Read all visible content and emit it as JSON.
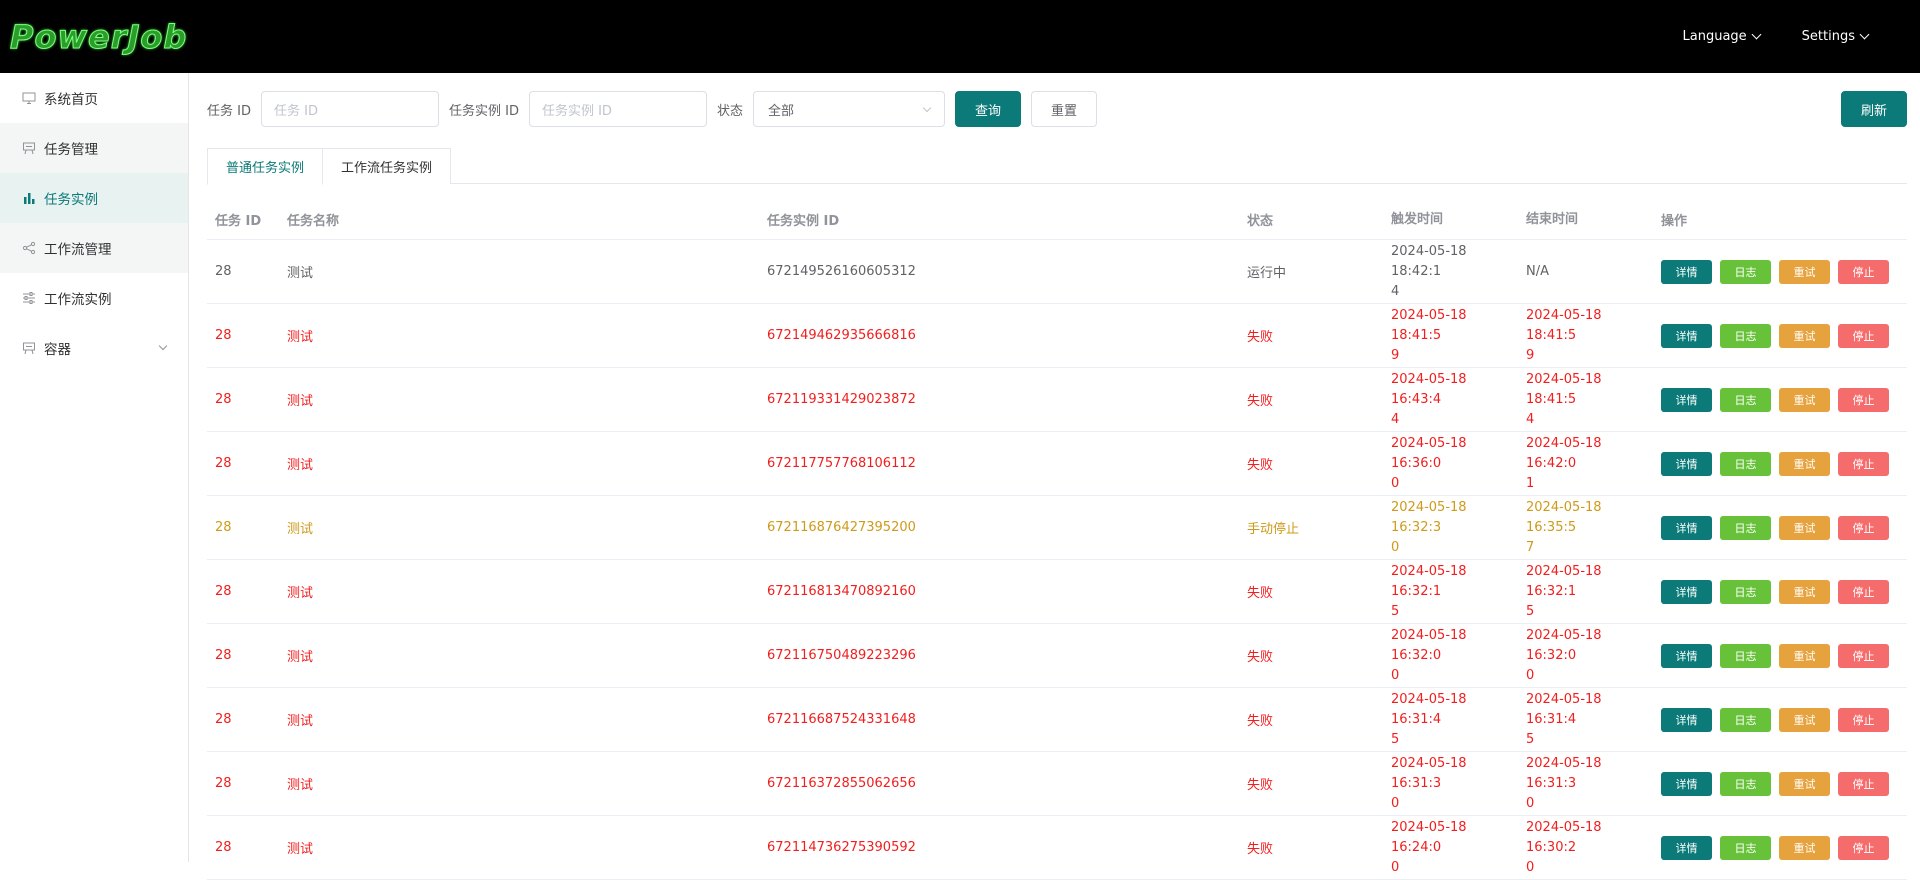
{
  "header": {
    "logo": "PowerJob",
    "language_label": "Language",
    "settings_label": "Settings"
  },
  "sidebar": {
    "items": [
      {
        "label": "系统首页",
        "icon": "monitor-icon"
      },
      {
        "label": "任务管理",
        "icon": "task-manage-icon"
      },
      {
        "label": "任务实例",
        "icon": "bar-chart-icon"
      },
      {
        "label": "工作流管理",
        "icon": "share-icon"
      },
      {
        "label": "工作流实例",
        "icon": "sliders-icon"
      },
      {
        "label": "容器",
        "icon": "container-icon"
      }
    ]
  },
  "filter": {
    "job_id_label": "任务 ID",
    "job_id_placeholder": "任务 ID",
    "instance_id_label": "任务实例 ID",
    "instance_id_placeholder": "任务实例 ID",
    "status_label": "状态",
    "status_value": "全部",
    "query_label": "查询",
    "reset_label": "重置",
    "refresh_label": "刷新"
  },
  "tabs": [
    {
      "label": "普通任务实例"
    },
    {
      "label": "工作流任务实例"
    }
  ],
  "table": {
    "headers": [
      "任务 ID",
      "任务名称",
      "任务实例 ID",
      "状态",
      "触发时间",
      "结束时间",
      "操作"
    ],
    "actions": {
      "detail": "详情",
      "log": "日志",
      "retry": "重试",
      "stop": "停止"
    },
    "rows": [
      {
        "job_id": "28",
        "name": "测试",
        "instance_id": "672149526160605312",
        "status": "运行中",
        "trigger_1": "2024-05-18 18:42:1",
        "trigger_2": "4",
        "end_1": "N/A",
        "end_2": ""
      },
      {
        "job_id": "28",
        "name": "测试",
        "instance_id": "672149462935666816",
        "status": "失败",
        "trigger_1": "2024-05-18 18:41:5",
        "trigger_2": "9",
        "end_1": "2024-05-18 18:41:5",
        "end_2": "9"
      },
      {
        "job_id": "28",
        "name": "测试",
        "instance_id": "672119331429023872",
        "status": "失败",
        "trigger_1": "2024-05-18 16:43:4",
        "trigger_2": "4",
        "end_1": "2024-05-18 18:41:5",
        "end_2": "4"
      },
      {
        "job_id": "28",
        "name": "测试",
        "instance_id": "672117757768106112",
        "status": "失败",
        "trigger_1": "2024-05-18 16:36:0",
        "trigger_2": "0",
        "end_1": "2024-05-18 16:42:0",
        "end_2": "1"
      },
      {
        "job_id": "28",
        "name": "测试",
        "instance_id": "672116876427395200",
        "status": "手动停止",
        "trigger_1": "2024-05-18 16:32:3",
        "trigger_2": "0",
        "end_1": "2024-05-18 16:35:5",
        "end_2": "7"
      },
      {
        "job_id": "28",
        "name": "测试",
        "instance_id": "672116813470892160",
        "status": "失败",
        "trigger_1": "2024-05-18 16:32:1",
        "trigger_2": "5",
        "end_1": "2024-05-18 16:32:1",
        "end_2": "5"
      },
      {
        "job_id": "28",
        "name": "测试",
        "instance_id": "672116750489223296",
        "status": "失败",
        "trigger_1": "2024-05-18 16:32:0",
        "trigger_2": "0",
        "end_1": "2024-05-18 16:32:0",
        "end_2": "0"
      },
      {
        "job_id": "28",
        "name": "测试",
        "instance_id": "672116687524331648",
        "status": "失败",
        "trigger_1": "2024-05-18 16:31:4",
        "trigger_2": "5",
        "end_1": "2024-05-18 16:31:4",
        "end_2": "5"
      },
      {
        "job_id": "28",
        "name": "测试",
        "instance_id": "672116372855062656",
        "status": "失败",
        "trigger_1": "2024-05-18 16:31:3",
        "trigger_2": "0",
        "end_1": "2024-05-18 16:31:3",
        "end_2": "0"
      },
      {
        "job_id": "28",
        "name": "测试",
        "instance_id": "672114736275390592",
        "status": "失败",
        "trigger_1": "2024-05-18 16:24:0",
        "trigger_2": "0",
        "end_1": "2024-05-18 16:30:2",
        "end_2": "0"
      }
    ]
  },
  "colors": {
    "primary": "#0b7a78",
    "failed": "#f21e1e",
    "stopped": "#cf9a19",
    "log_button": "#67c23a",
    "retry_button": "#e6a23c",
    "stop_button": "#f56c6c"
  }
}
